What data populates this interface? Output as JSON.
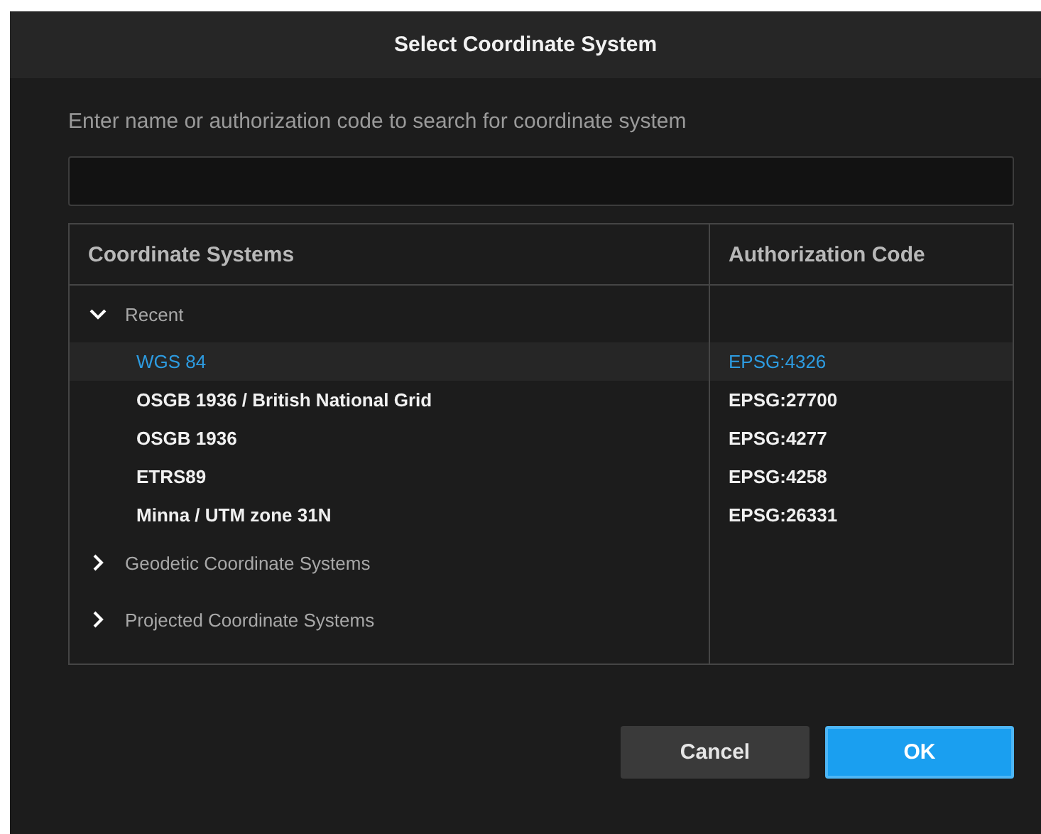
{
  "window": {
    "title": "Select Coordinate System"
  },
  "search": {
    "label": "Enter name or authorization code to search for coordinate system"
  },
  "table": {
    "columns": [
      "Coordinate Systems",
      "Authorization Code"
    ],
    "groups": [
      {
        "label": "Recent",
        "expanded": true,
        "children": [
          {
            "name": "WGS 84",
            "code": "EPSG:4326",
            "selected": true
          },
          {
            "name": "OSGB 1936 / British National Grid",
            "code": "EPSG:27700",
            "selected": false
          },
          {
            "name": "OSGB 1936",
            "code": "EPSG:4277",
            "selected": false
          },
          {
            "name": "ETRS89",
            "code": "EPSG:4258",
            "selected": false
          },
          {
            "name": "Minna / UTM zone 31N",
            "code": "EPSG:26331",
            "selected": false
          }
        ]
      },
      {
        "label": "Geodetic Coordinate Systems",
        "expanded": false
      },
      {
        "label": "Projected Coordinate Systems",
        "expanded": false
      }
    ]
  },
  "buttons": [
    {
      "label": "Cancel",
      "kind": "secondary"
    },
    {
      "label": "OK",
      "kind": "primary"
    }
  ]
}
